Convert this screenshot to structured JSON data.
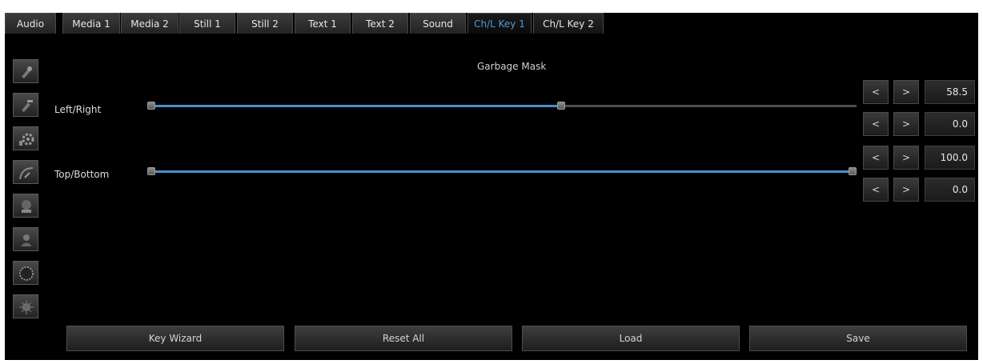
{
  "tabs": [
    "Audio",
    "Media 1",
    "Media 2",
    "Still 1",
    "Still 2",
    "Text 1",
    "Text 2",
    "Sound",
    "Ch/L Key 1",
    "Ch/L Key 2"
  ],
  "active_tab": "Ch/L Key 1",
  "panel": {
    "title": "Garbage Mask"
  },
  "tools": [
    "pen-add-icon",
    "pen-remove-icon",
    "settings-icon",
    "curve-icon",
    "chroma-icon",
    "person-icon",
    "mask-ring-icon",
    "brush-icon"
  ],
  "sliders": [
    {
      "label": "Left/Right",
      "start": 0.0,
      "end": 58.5
    },
    {
      "label": "Top/Bottom",
      "start": 0.0,
      "end": 100.0
    }
  ],
  "values": [
    "58.5",
    "0.0",
    "100.0",
    "0.0"
  ],
  "step": {
    "decrease": "<",
    "increase": ">"
  },
  "actions": {
    "key_wizard": "Key Wizard",
    "reset_all": "Reset All",
    "load": "Load",
    "save": "Save"
  },
  "colors": {
    "accent": "#4a8fd0",
    "active_tab_text": "#4f9ad6",
    "background": "#000000"
  }
}
